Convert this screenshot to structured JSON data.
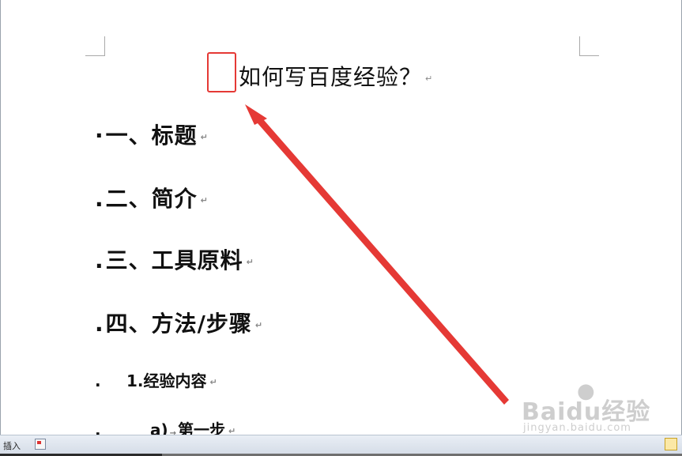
{
  "document": {
    "title": "如何写百度经验？",
    "para_mark": "↵",
    "headings": [
      {
        "bullet": "·",
        "text": "一、标题"
      },
      {
        "bullet": ".",
        "text": "二、简介"
      },
      {
        "bullet": ".",
        "text": "三、工具原料"
      },
      {
        "bullet": ".",
        "text": "四、方法/步骤"
      }
    ],
    "sub_items": [
      {
        "bullet": ".",
        "text": "1.经验内容"
      },
      {
        "bullet": ".",
        "prefix": "a)",
        "tab": "→",
        "text": "第一步"
      }
    ]
  },
  "annotation": {
    "color": "#e53935"
  },
  "watermark": {
    "brand": "Baidu经验",
    "url": "jingyan.baidu.com"
  },
  "statusbar": {
    "mode": "插入"
  }
}
